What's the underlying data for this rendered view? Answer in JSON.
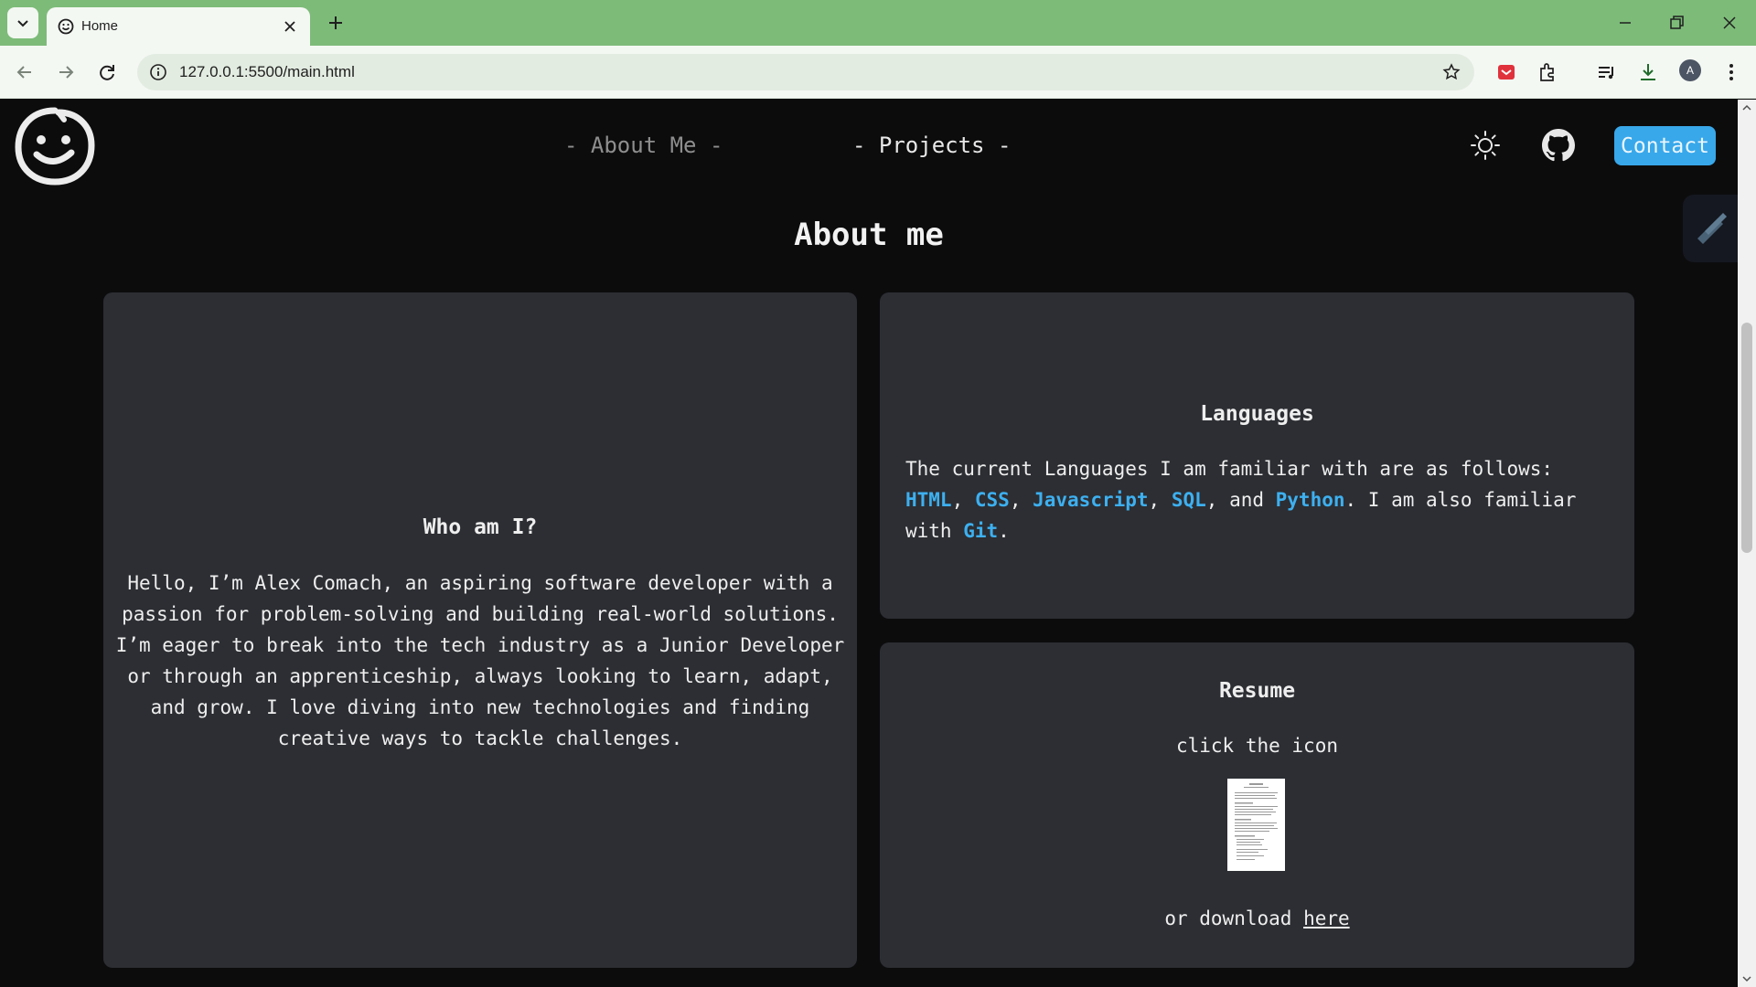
{
  "browser": {
    "tab_title": "Home",
    "url": "127.0.0.1:5500/main.html",
    "profile_initial": "A"
  },
  "site": {
    "nav": {
      "about_label": "- About Me -",
      "projects_label": "- Projects -",
      "contact_label": "Contact"
    },
    "heading": "About me",
    "who": {
      "title": "Who am I?",
      "text": "Hello, I’m Alex Comach, an aspiring software developer with a passion for problem-solving and building real-world solutions. I’m eager to break into the tech industry as a Junior Developer or through an apprenticeship, always looking to learn, adapt, and grow. I love diving into new technologies and finding creative ways to tackle challenges."
    },
    "languages": {
      "title": "Languages",
      "intro": "The current Languages I am familiar with are as follows: ",
      "items": [
        "HTML",
        "CSS",
        "Javascript",
        "SQL",
        "Python"
      ],
      "sep1": ", ",
      "sep2": ", ",
      "sep3": ", ",
      "sep4": ", and ",
      "also": ". I am also familiar with ",
      "tool": "Git",
      "end": "."
    },
    "resume": {
      "title": "Resume",
      "hint": "click the icon",
      "download_prefix": "or download ",
      "download_link": "here"
    }
  },
  "colors": {
    "chrome_frame": "#7dbb79",
    "page_bg": "#0c0c0d",
    "card_bg": "#2c2e33",
    "accent": "#3db0f0",
    "contact_bg": "#38a8ea"
  },
  "icons": {
    "tab_search": "chevron-down-icon",
    "favicon": "smiley-icon",
    "theme": "sun-icon",
    "github": "github-icon",
    "logo": "smiley-logo"
  }
}
